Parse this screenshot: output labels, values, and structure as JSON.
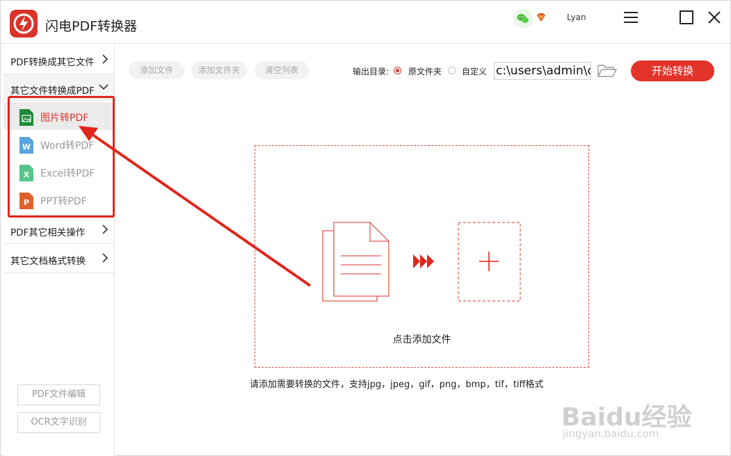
{
  "app": {
    "title": "闪电PDF转换器",
    "username": "Lyan",
    "brand_color": "#d9342b"
  },
  "sidebar": {
    "categories": [
      {
        "label": "PDF转换成其它文件",
        "expanded": false
      },
      {
        "label": "其它文件转换成PDF",
        "expanded": true
      },
      {
        "label": "PDF其它相关操作",
        "expanded": false
      },
      {
        "label": "其它文档格式转换",
        "expanded": false
      }
    ],
    "subitems": [
      {
        "label": "图片转PDF",
        "icon": "image-file-icon",
        "letter": "",
        "active": true
      },
      {
        "label": "Word转PDF",
        "icon": "word-file-icon",
        "letter": "W",
        "active": false
      },
      {
        "label": "Excel转PDF",
        "icon": "excel-file-icon",
        "letter": "X",
        "active": false
      },
      {
        "label": "PPT转PDF",
        "icon": "ppt-file-icon",
        "letter": "P",
        "active": false
      }
    ],
    "bottom_buttons": [
      "PDF文件编辑",
      "OCR文字识别"
    ]
  },
  "toolbar": {
    "add_file": "添加文件",
    "add_folder": "添加文件夹",
    "clear_list": "清空列表",
    "output_label": "输出目录:",
    "option_original": "原文件夹",
    "option_custom": "自定义",
    "selected_option": "原文件夹",
    "path_value": "c:\\users\\admin\\d",
    "start_button": "开始转换"
  },
  "dropzone": {
    "label": "点击添加文件",
    "hint": "请添加需要转换的文件，支持jpg，jpeg，gif，png，bmp，tif，tiff格式"
  },
  "watermark": {
    "main": "Baidu经验",
    "sub": "jingyan.baidu.com"
  }
}
